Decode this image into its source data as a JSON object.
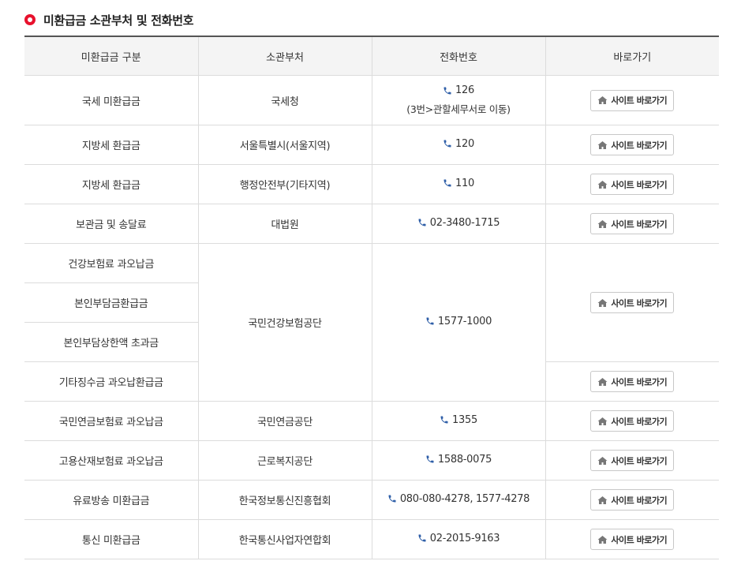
{
  "title": "미환급금 소관부처 및 전화번호",
  "headers": [
    "미환급금 구분",
    "소관부처",
    "전화번호",
    "바로가기"
  ],
  "button_label": "사이트 바로가기",
  "rows": [
    {
      "category": "국세 미환급금",
      "agency": "국세청",
      "phone": "126",
      "phone_note": "(3번>관할세무서로 이동)"
    },
    {
      "category": "지방세 환급금",
      "agency": "서울특별시(서울지역)",
      "phone": "120"
    },
    {
      "category": "지방세 환급금",
      "agency": "행정안전부(기타지역)",
      "phone": "110"
    },
    {
      "category": "보관금 및 송달료",
      "agency": "대법원",
      "phone": "02-3480-1715"
    },
    {
      "category": "건강보험료 과오납금",
      "agency": "국민건강보험공단",
      "phone": "1577-1000"
    },
    {
      "category": "본인부담금환급금"
    },
    {
      "category": "본인부담상한액 초과금"
    },
    {
      "category": "기타징수금 과오납환급금"
    },
    {
      "category": "국민연금보험료 과오납금",
      "agency": "국민연금공단",
      "phone": "1355"
    },
    {
      "category": "고용산재보험료 과오납금",
      "agency": "근로복지공단",
      "phone": "1588-0075"
    },
    {
      "category": "유료방송 미환급금",
      "agency": "한국정보통신진흥협회",
      "phone": "080-080-4278, 1577-4278"
    },
    {
      "category": "통신 미환급금",
      "agency": "한국통신사업자연합회",
      "phone": "02-2015-9163"
    }
  ],
  "colors": {
    "accent_red": "#e8112d",
    "phone_icon": "#2f5fa8",
    "header_bg": "#f4f4f4"
  }
}
